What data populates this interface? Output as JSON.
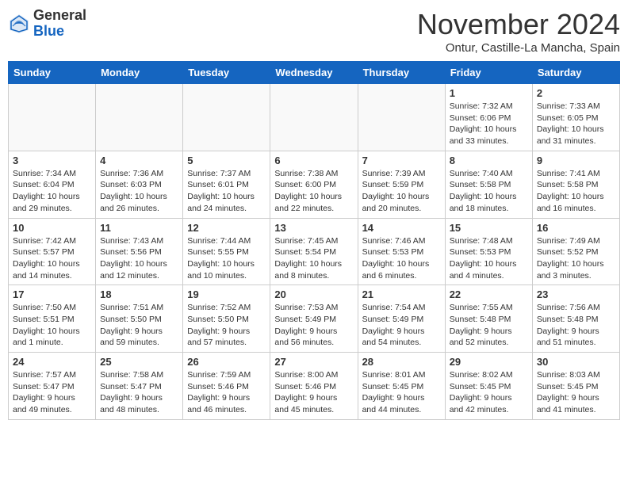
{
  "header": {
    "logo_line1": "General",
    "logo_line2": "Blue",
    "month": "November 2024",
    "location": "Ontur, Castille-La Mancha, Spain"
  },
  "weekdays": [
    "Sunday",
    "Monday",
    "Tuesday",
    "Wednesday",
    "Thursday",
    "Friday",
    "Saturday"
  ],
  "weeks": [
    [
      {
        "day": "",
        "info": ""
      },
      {
        "day": "",
        "info": ""
      },
      {
        "day": "",
        "info": ""
      },
      {
        "day": "",
        "info": ""
      },
      {
        "day": "",
        "info": ""
      },
      {
        "day": "1",
        "info": "Sunrise: 7:32 AM\nSunset: 6:06 PM\nDaylight: 10 hours\nand 33 minutes."
      },
      {
        "day": "2",
        "info": "Sunrise: 7:33 AM\nSunset: 6:05 PM\nDaylight: 10 hours\nand 31 minutes."
      }
    ],
    [
      {
        "day": "3",
        "info": "Sunrise: 7:34 AM\nSunset: 6:04 PM\nDaylight: 10 hours\nand 29 minutes."
      },
      {
        "day": "4",
        "info": "Sunrise: 7:36 AM\nSunset: 6:03 PM\nDaylight: 10 hours\nand 26 minutes."
      },
      {
        "day": "5",
        "info": "Sunrise: 7:37 AM\nSunset: 6:01 PM\nDaylight: 10 hours\nand 24 minutes."
      },
      {
        "day": "6",
        "info": "Sunrise: 7:38 AM\nSunset: 6:00 PM\nDaylight: 10 hours\nand 22 minutes."
      },
      {
        "day": "7",
        "info": "Sunrise: 7:39 AM\nSunset: 5:59 PM\nDaylight: 10 hours\nand 20 minutes."
      },
      {
        "day": "8",
        "info": "Sunrise: 7:40 AM\nSunset: 5:58 PM\nDaylight: 10 hours\nand 18 minutes."
      },
      {
        "day": "9",
        "info": "Sunrise: 7:41 AM\nSunset: 5:58 PM\nDaylight: 10 hours\nand 16 minutes."
      }
    ],
    [
      {
        "day": "10",
        "info": "Sunrise: 7:42 AM\nSunset: 5:57 PM\nDaylight: 10 hours\nand 14 minutes."
      },
      {
        "day": "11",
        "info": "Sunrise: 7:43 AM\nSunset: 5:56 PM\nDaylight: 10 hours\nand 12 minutes."
      },
      {
        "day": "12",
        "info": "Sunrise: 7:44 AM\nSunset: 5:55 PM\nDaylight: 10 hours\nand 10 minutes."
      },
      {
        "day": "13",
        "info": "Sunrise: 7:45 AM\nSunset: 5:54 PM\nDaylight: 10 hours\nand 8 minutes."
      },
      {
        "day": "14",
        "info": "Sunrise: 7:46 AM\nSunset: 5:53 PM\nDaylight: 10 hours\nand 6 minutes."
      },
      {
        "day": "15",
        "info": "Sunrise: 7:48 AM\nSunset: 5:53 PM\nDaylight: 10 hours\nand 4 minutes."
      },
      {
        "day": "16",
        "info": "Sunrise: 7:49 AM\nSunset: 5:52 PM\nDaylight: 10 hours\nand 3 minutes."
      }
    ],
    [
      {
        "day": "17",
        "info": "Sunrise: 7:50 AM\nSunset: 5:51 PM\nDaylight: 10 hours\nand 1 minute."
      },
      {
        "day": "18",
        "info": "Sunrise: 7:51 AM\nSunset: 5:50 PM\nDaylight: 9 hours\nand 59 minutes."
      },
      {
        "day": "19",
        "info": "Sunrise: 7:52 AM\nSunset: 5:50 PM\nDaylight: 9 hours\nand 57 minutes."
      },
      {
        "day": "20",
        "info": "Sunrise: 7:53 AM\nSunset: 5:49 PM\nDaylight: 9 hours\nand 56 minutes."
      },
      {
        "day": "21",
        "info": "Sunrise: 7:54 AM\nSunset: 5:49 PM\nDaylight: 9 hours\nand 54 minutes."
      },
      {
        "day": "22",
        "info": "Sunrise: 7:55 AM\nSunset: 5:48 PM\nDaylight: 9 hours\nand 52 minutes."
      },
      {
        "day": "23",
        "info": "Sunrise: 7:56 AM\nSunset: 5:48 PM\nDaylight: 9 hours\nand 51 minutes."
      }
    ],
    [
      {
        "day": "24",
        "info": "Sunrise: 7:57 AM\nSunset: 5:47 PM\nDaylight: 9 hours\nand 49 minutes."
      },
      {
        "day": "25",
        "info": "Sunrise: 7:58 AM\nSunset: 5:47 PM\nDaylight: 9 hours\nand 48 minutes."
      },
      {
        "day": "26",
        "info": "Sunrise: 7:59 AM\nSunset: 5:46 PM\nDaylight: 9 hours\nand 46 minutes."
      },
      {
        "day": "27",
        "info": "Sunrise: 8:00 AM\nSunset: 5:46 PM\nDaylight: 9 hours\nand 45 minutes."
      },
      {
        "day": "28",
        "info": "Sunrise: 8:01 AM\nSunset: 5:45 PM\nDaylight: 9 hours\nand 44 minutes."
      },
      {
        "day": "29",
        "info": "Sunrise: 8:02 AM\nSunset: 5:45 PM\nDaylight: 9 hours\nand 42 minutes."
      },
      {
        "day": "30",
        "info": "Sunrise: 8:03 AM\nSunset: 5:45 PM\nDaylight: 9 hours\nand 41 minutes."
      }
    ]
  ]
}
